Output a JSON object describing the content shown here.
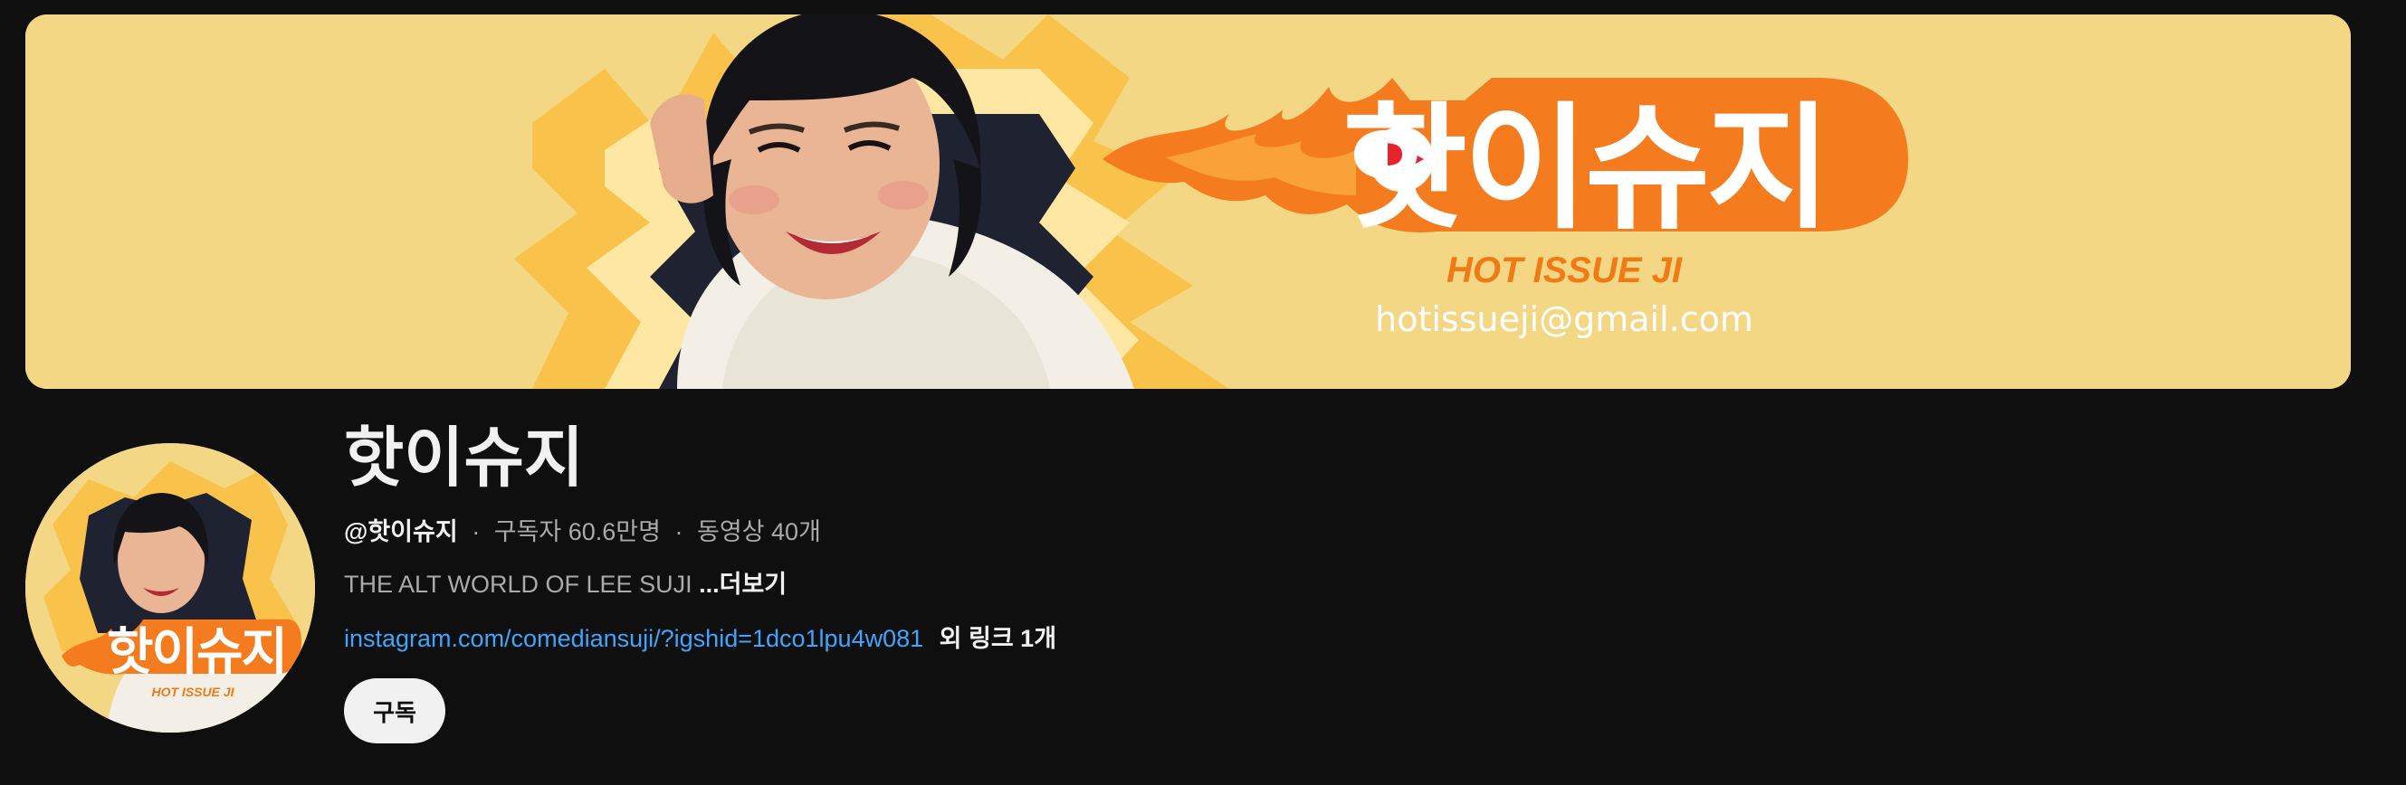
{
  "banner": {
    "logo_text": "핫이슈지",
    "subtitle": "HOT ISSUE JI",
    "email": "hotissueji@gmail.com",
    "colors": {
      "background": "#f4d784",
      "flame": "#f47c1f",
      "subtitle": "#f07a16",
      "play_red": "#e8232b"
    }
  },
  "avatar": {
    "logo_text": "핫이슈지",
    "subtitle": "HOT ISSUE JI"
  },
  "channel": {
    "name": "핫이슈지",
    "handle": "@핫이슈지",
    "separator": "·",
    "subscribers": "구독자 60.6만명",
    "videos": "동영상 40개",
    "description": "THE ALT WORLD OF LEE SUJI",
    "more_label": "...더보기",
    "link_text": "instagram.com/comediansuji/?igshid=1dco1lpu4w081",
    "extra_links": "외 링크 1개",
    "subscribe_label": "구독"
  }
}
